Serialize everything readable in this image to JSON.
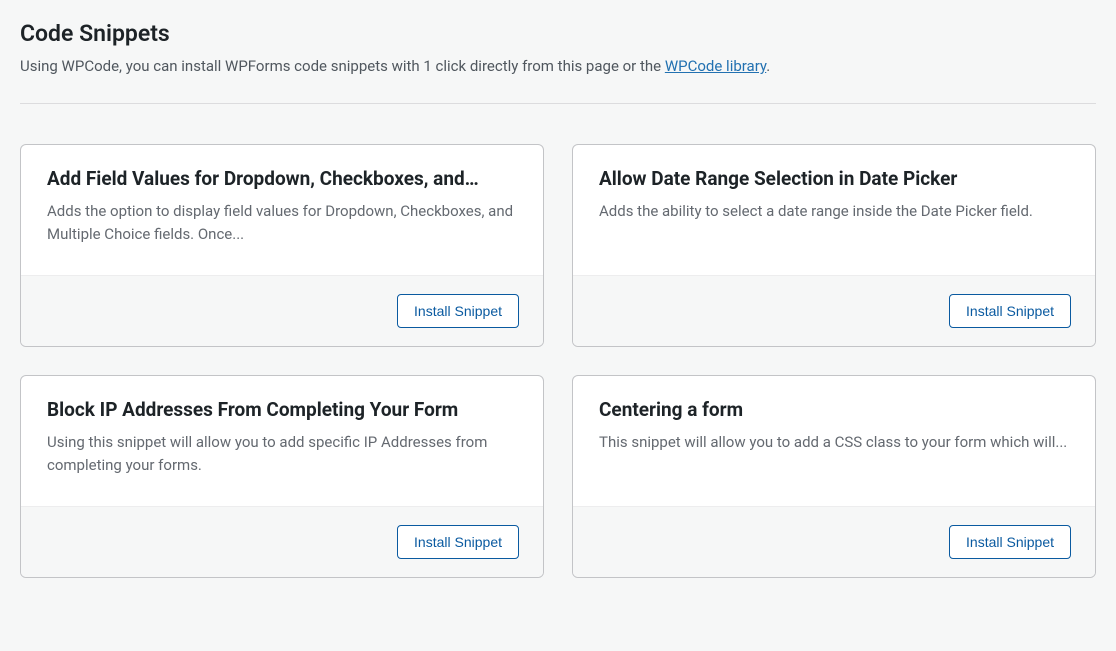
{
  "header": {
    "title": "Code Snippets",
    "description_before": "Using WPCode, you can install WPForms code snippets with 1 click directly from this page or the ",
    "link_text": "WPCode library",
    "description_after": "."
  },
  "button_label": "Install Snippet",
  "snippets": [
    {
      "title": "Add Field Values for Dropdown, Checkboxes, and…",
      "description": "Adds the option to display field values for Dropdown, Checkboxes, and Multiple Choice fields. Once..."
    },
    {
      "title": "Allow Date Range Selection in Date Picker",
      "description": "Adds the ability to select a date range inside the Date Picker field."
    },
    {
      "title": "Block IP Addresses From Completing Your Form",
      "description": "Using this snippet will allow you to add specific IP Addresses from completing your forms."
    },
    {
      "title": "Centering a form",
      "description": "This snippet will allow you to add a CSS class to your form which will..."
    }
  ]
}
